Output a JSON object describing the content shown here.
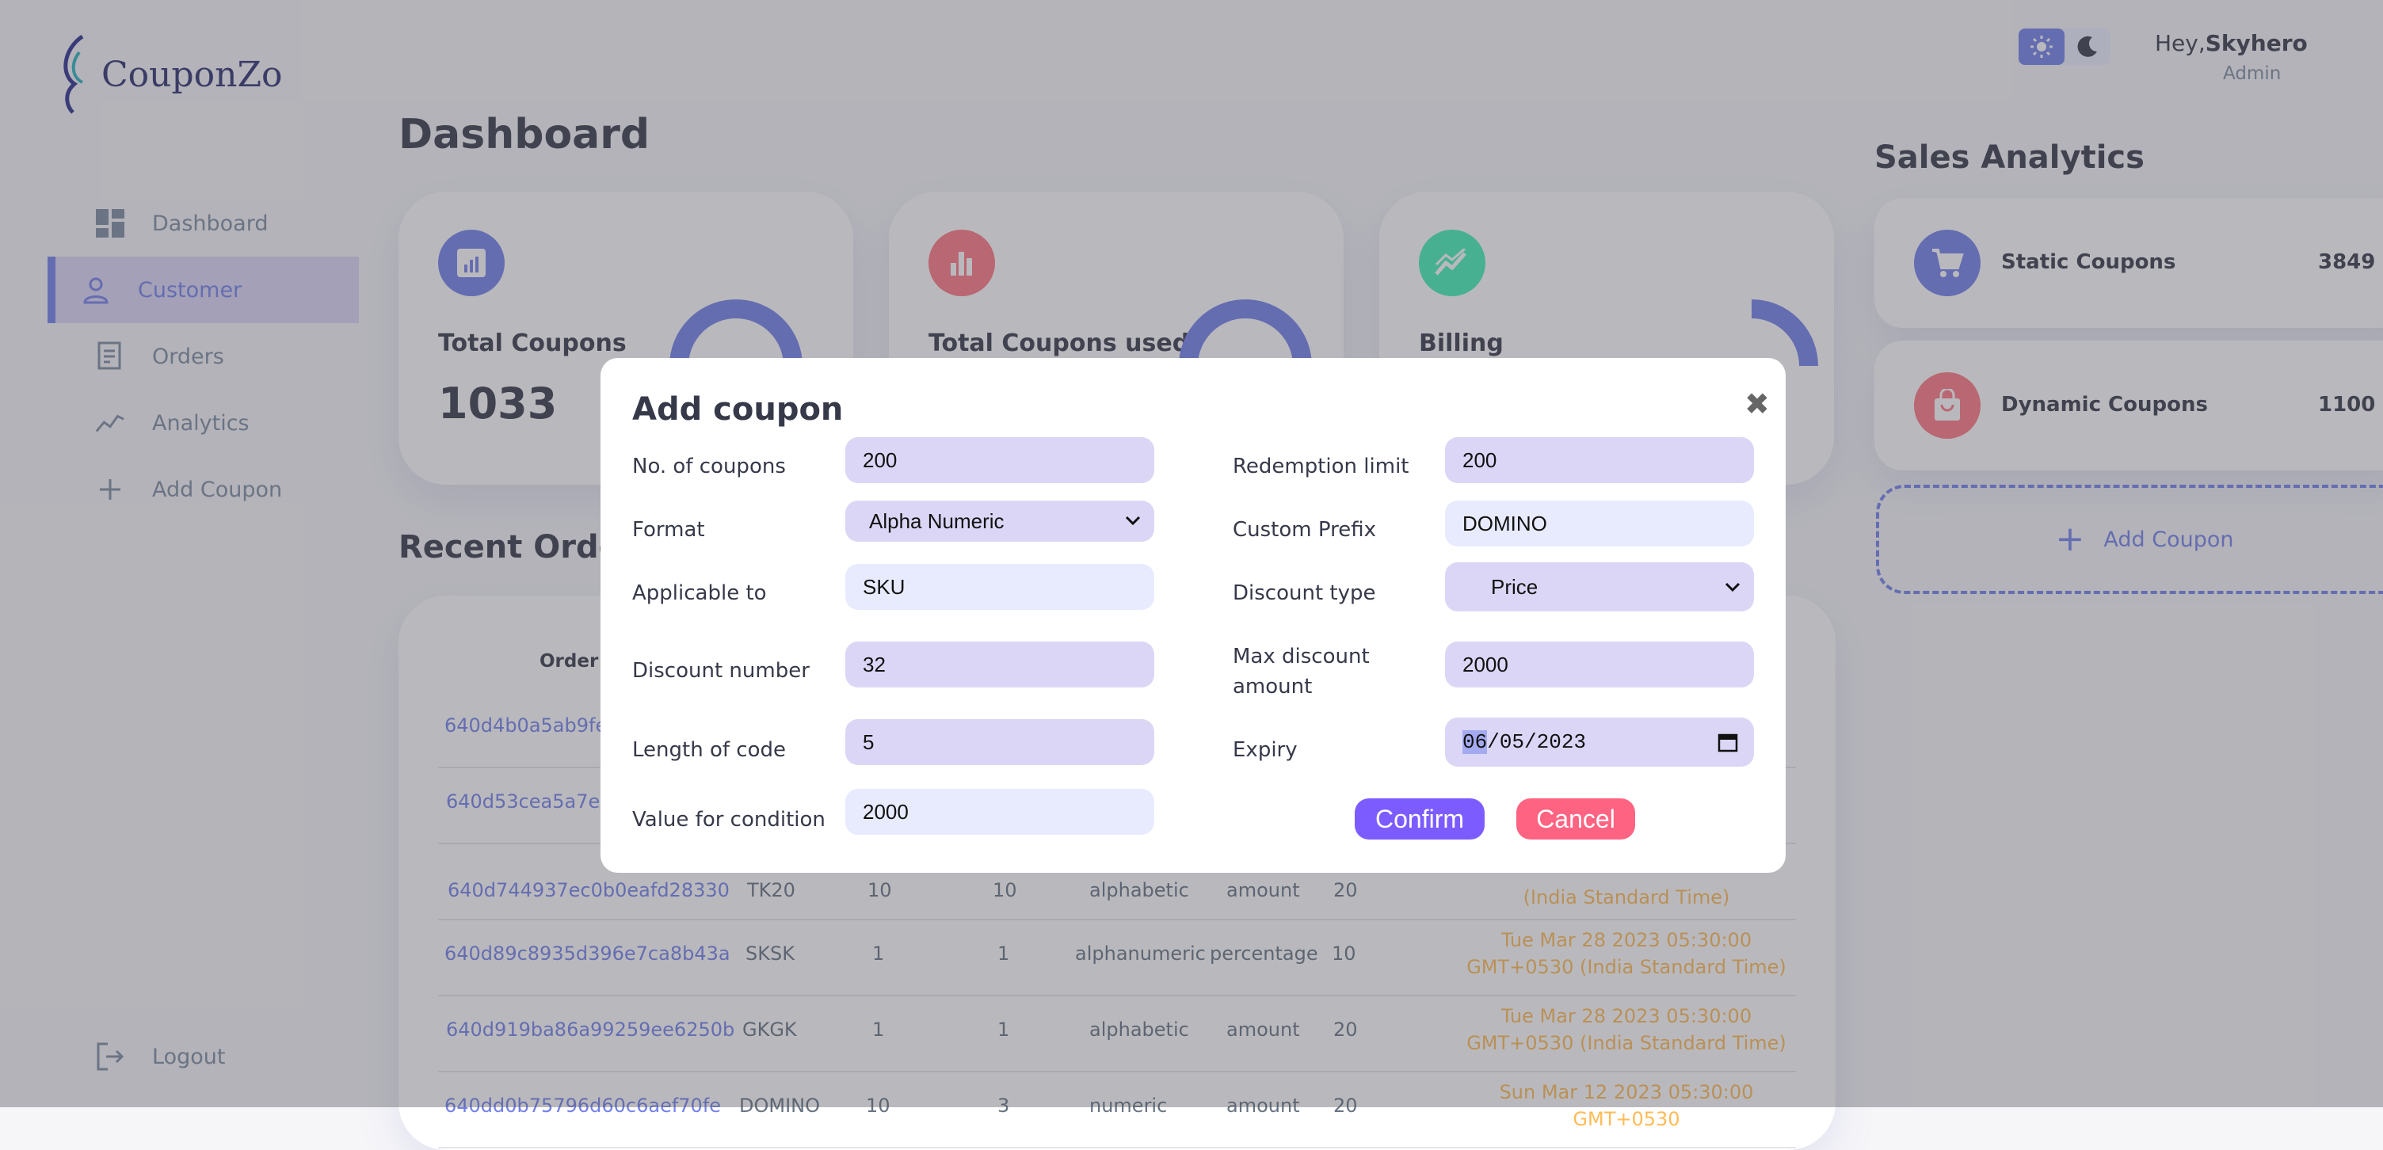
{
  "app": {
    "brand": "CouponZo"
  },
  "sidebar": {
    "items": [
      {
        "label": "Dashboard",
        "icon": "grid-icon"
      },
      {
        "label": "Customer",
        "icon": "person-icon"
      },
      {
        "label": "Orders",
        "icon": "receipt-icon"
      },
      {
        "label": "Analytics",
        "icon": "trend-icon"
      },
      {
        "label": "Add Coupon",
        "icon": "plus-icon"
      }
    ],
    "active_index": 1,
    "logout_label": "Logout"
  },
  "header": {
    "greeting": "Hey,",
    "username": "Skyhero",
    "role": "Admin",
    "theme": {
      "light_icon": "sun-icon",
      "dark_icon": "moon-icon",
      "selected": "light"
    }
  },
  "main": {
    "title": "Dashboard",
    "cards": [
      {
        "title": "Total Coupons",
        "value": "1033",
        "color": "#7380ec",
        "icon": "chart-icon"
      },
      {
        "title": "Total Coupons used",
        "value": "",
        "color": "#ff7782",
        "icon": "bar-chart-icon"
      },
      {
        "title": "Billing",
        "value": "",
        "color": "#41f1b6",
        "icon": "stocks-icon"
      }
    ],
    "recent_orders_title": "Recent Orders",
    "orders_header": {
      "order_id": "Order ID"
    },
    "orders": [
      {
        "id": "640d4b0a5ab9fe",
        "prefix": "",
        "count": "",
        "used": "",
        "format": "",
        "type": "",
        "value": "",
        "date": ""
      },
      {
        "id": "640d53cea5a7e6",
        "prefix": "",
        "count": "",
        "used": "",
        "format": "",
        "type": "",
        "value": "",
        "date": ""
      },
      {
        "id": "640d744937ec0b0eafd28330",
        "prefix": "TK20",
        "count": "10",
        "used": "10",
        "format": "alphabetic",
        "type": "amount",
        "value": "20",
        "date": "(India Standard Time)"
      },
      {
        "id": "640d89c8935d396e7ca8b43a",
        "prefix": "SKSK",
        "count": "1",
        "used": "1",
        "format": "alphanumeric",
        "type": "percentage",
        "value": "10",
        "date": "Tue Mar 28 2023 05:30:00 GMT+0530 (India Standard Time)"
      },
      {
        "id": "640d919ba86a99259ee6250b",
        "prefix": "GKGK",
        "count": "1",
        "used": "1",
        "format": "alphabetic",
        "type": "amount",
        "value": "20",
        "date": "Tue Mar 28 2023 05:30:00 GMT+0530 (India Standard Time)"
      },
      {
        "id": "640dd0b75796d60c6aef70fe",
        "prefix": "DOMINO",
        "count": "10",
        "used": "3",
        "format": "numeric",
        "type": "amount",
        "value": "20",
        "date": "Sun Mar 12 2023 05:30:00 GMT+0530"
      }
    ]
  },
  "right": {
    "title": "Sales Analytics",
    "items": [
      {
        "name": "Static Coupons",
        "value": "3849",
        "color": "#7380ec",
        "icon": "cart-icon"
      },
      {
        "name": "Dynamic Coupons",
        "value": "1100",
        "color": "#ff7782",
        "icon": "bag-icon"
      }
    ],
    "add_coupon_label": "Add Coupon"
  },
  "modal": {
    "title": "Add coupon",
    "close_icon": "close-icon",
    "fields": {
      "no_of_coupons": {
        "label": "No. of coupons",
        "value": "200"
      },
      "redemption_limit": {
        "label": "Redemption limit",
        "value": "200"
      },
      "format": {
        "label": "Format",
        "value": "Alpha Numeric"
      },
      "custom_prefix": {
        "label": "Custom Prefix",
        "value": "DOMINO"
      },
      "applicable_to": {
        "label": "Applicable to",
        "value": "SKU"
      },
      "discount_type": {
        "label": "Discount type",
        "value": "Price"
      },
      "discount_number": {
        "label": "Discount number",
        "value": "32"
      },
      "max_discount": {
        "label_line1": "Max discount",
        "label_line2": "amount",
        "value": "2000"
      },
      "length_of_code": {
        "label": "Length of code",
        "value": "5"
      },
      "expiry": {
        "label": "Expiry",
        "month": "06",
        "rest": "/05/2023"
      },
      "value_for_condition": {
        "label": "Value for condition",
        "value": "2000"
      }
    },
    "confirm_label": "Confirm",
    "cancel_label": "Cancel",
    "confirm_color": "#7c5cff",
    "cancel_color": "#ff6382"
  }
}
